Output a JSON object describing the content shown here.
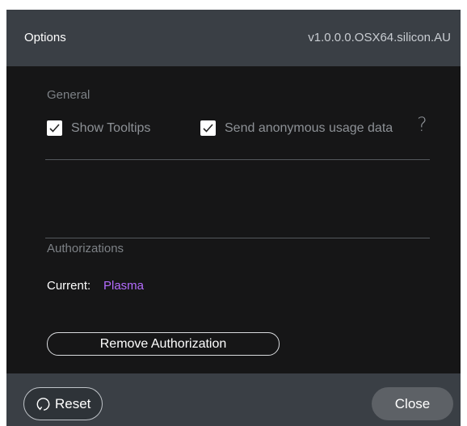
{
  "dialog": {
    "title": "Options",
    "version": "v1.0.0.0.OSX64.silicon.AU"
  },
  "general": {
    "heading": "General",
    "show_tooltips": {
      "label": "Show Tooltips",
      "checked": true
    },
    "send_usage": {
      "label": "Send anonymous usage data",
      "checked": true
    },
    "help_glyph": "?"
  },
  "authorizations": {
    "heading": "Authorizations",
    "current_label": "Current:",
    "current_value": "Plasma",
    "remove_label": "Remove Authorization"
  },
  "footer": {
    "reset_label": "Reset",
    "reset_icon": "reset-icon",
    "close_label": "Close"
  },
  "colors": {
    "accent": "#b46cff",
    "panel": "#161617",
    "bar": "#3a3f45"
  }
}
